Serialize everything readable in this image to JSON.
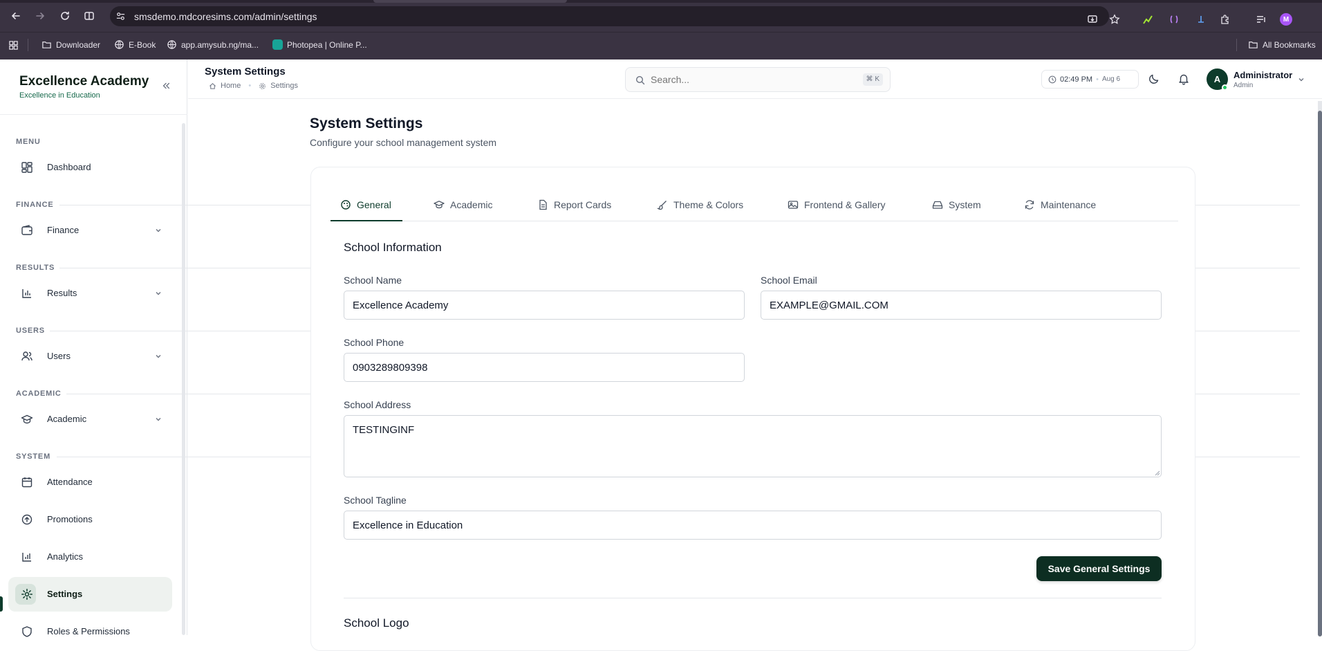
{
  "browser": {
    "url": "smsdemo.mdcoresims.com/admin/settings",
    "bookmarks": [
      "Downloader",
      "E-Book",
      "app.amysub.ng/ma...",
      "Photopea | Online P..."
    ],
    "all_bookmarks": "All Bookmarks",
    "profile_initial": "M"
  },
  "brand": {
    "name": "Excellence Academy",
    "tagline": "Excellence in Education"
  },
  "sidebar": {
    "sections": [
      {
        "label": "MENU",
        "items": [
          {
            "label": "Dashboard",
            "icon": "dashboard-icon"
          }
        ]
      },
      {
        "label": "FINANCE",
        "items": [
          {
            "label": "Finance",
            "icon": "wallet-icon",
            "expandable": true
          }
        ]
      },
      {
        "label": "RESULTS",
        "items": [
          {
            "label": "Results",
            "icon": "bar-chart-icon",
            "expandable": true
          }
        ]
      },
      {
        "label": "USERS",
        "items": [
          {
            "label": "Users",
            "icon": "users-icon",
            "expandable": true
          }
        ]
      },
      {
        "label": "ACADEMIC",
        "items": [
          {
            "label": "Academic",
            "icon": "graduation-cap-icon",
            "expandable": true
          }
        ]
      },
      {
        "label": "SYSTEM",
        "items": [
          {
            "label": "Attendance",
            "icon": "calendar-icon"
          },
          {
            "label": "Promotions",
            "icon": "arrow-up-circle-icon"
          },
          {
            "label": "Analytics",
            "icon": "analytics-icon"
          },
          {
            "label": "Settings",
            "icon": "gear-icon",
            "active": true
          },
          {
            "label": "Roles & Permissions",
            "icon": "shield-icon"
          }
        ]
      }
    ]
  },
  "header": {
    "title": "System Settings",
    "breadcrumb": [
      "Home",
      "Settings"
    ],
    "search_placeholder": "Search...",
    "search_shortcut": "⌘ K",
    "time": "02:49 PM",
    "date": "Aug 6",
    "user_initial": "A",
    "user_name": "Administrator",
    "user_role": "Admin"
  },
  "page": {
    "title": "System Settings",
    "subtitle": "Configure your school management system",
    "tabs": [
      {
        "label": "General",
        "icon": "palette-icon",
        "active": true
      },
      {
        "label": "Academic",
        "icon": "graduation-cap-icon"
      },
      {
        "label": "Report Cards",
        "icon": "file-text-icon"
      },
      {
        "label": "Theme & Colors",
        "icon": "brush-icon"
      },
      {
        "label": "Frontend & Gallery",
        "icon": "image-icon"
      },
      {
        "label": "System",
        "icon": "hard-drive-icon"
      },
      {
        "label": "Maintenance",
        "icon": "refresh-icon"
      }
    ],
    "section_title": "School Information",
    "fields": {
      "school_name": {
        "label": "School Name",
        "value": "Excellence Academy"
      },
      "school_email": {
        "label": "School Email",
        "value": "EXAMPLE@GMAIL.COM"
      },
      "school_phone": {
        "label": "School Phone",
        "value": "0903289809398"
      },
      "school_address": {
        "label": "School Address",
        "value": "TESTINGINF"
      },
      "school_tagline": {
        "label": "School Tagline",
        "value": "Excellence in Education"
      }
    },
    "save_label": "Save General Settings",
    "logo_section_title": "School Logo"
  },
  "colors": {
    "brand_dark": "#0d3b2b",
    "button_dark": "#0d2e22",
    "online": "#22c55e",
    "chrome": "#3a3342"
  }
}
